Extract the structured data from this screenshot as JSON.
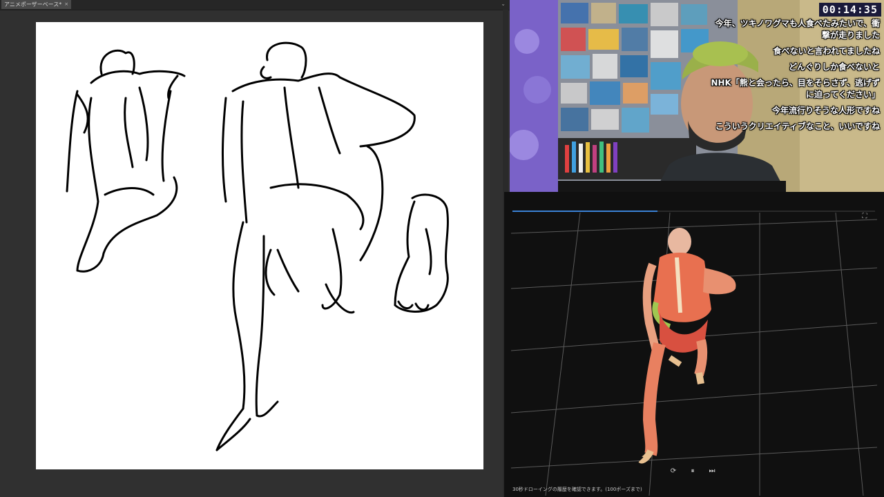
{
  "drawing_app": {
    "document_tab": "アニメポーザーベース*",
    "tab_close_icon": "close-icon",
    "tab_menu_icon": "chevron-down-icon"
  },
  "webcam": {
    "timer": "00:14:35",
    "comments": [
      "今年、ツキノワグマも人食べたみたいで、衝撃が走りました",
      "食べないと言われてましたね",
      "どんぐりしか食べないと",
      "NHK「熊と会ったら、目をそらさず、逃げずに迫ってください」",
      "今年流行りそうな人形ですね",
      "こういうクリエイティブなこと、いいですね"
    ]
  },
  "viewer": {
    "progress": 0.4,
    "fullscreen_icon": "fullscreen-icon",
    "controls": {
      "replay_icon": "replay-icon",
      "pause_icon": "pause-icon",
      "next_icon": "fast-forward-icon"
    },
    "caption": "30秒ドローイングの履歴を確認できます。(100ポーズまで)"
  }
}
